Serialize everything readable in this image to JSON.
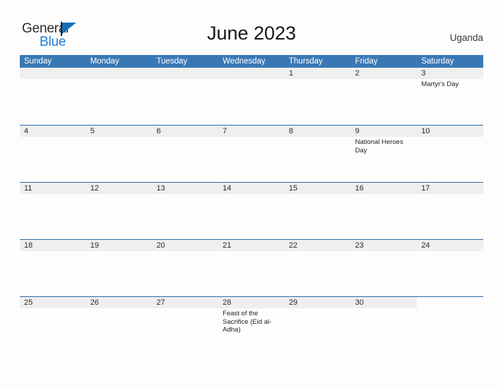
{
  "brand": {
    "name_part1": "General",
    "name_part2": "Blue",
    "flag_icon": "flag-triangle-icon",
    "accent_blue": "#1570b8"
  },
  "header": {
    "title": "June 2023",
    "region": "Uganda"
  },
  "colors": {
    "weekday_header_bg": "#3a78b5",
    "week_divider": "#2b6ca8",
    "daynum_band_bg": "#efefef",
    "page_bg": "#fdfdfd",
    "text": "#2b2b2b"
  },
  "calendar": {
    "month": "June",
    "year": "2023",
    "weekday_headers": [
      "Sunday",
      "Monday",
      "Tuesday",
      "Wednesday",
      "Thursday",
      "Friday",
      "Saturday"
    ],
    "weeks": [
      [
        {
          "day": "",
          "events": []
        },
        {
          "day": "",
          "events": []
        },
        {
          "day": "",
          "events": []
        },
        {
          "day": "",
          "events": []
        },
        {
          "day": "1",
          "events": []
        },
        {
          "day": "2",
          "events": []
        },
        {
          "day": "3",
          "events": [
            "Martyr's Day"
          ]
        }
      ],
      [
        {
          "day": "4",
          "events": []
        },
        {
          "day": "5",
          "events": []
        },
        {
          "day": "6",
          "events": []
        },
        {
          "day": "7",
          "events": []
        },
        {
          "day": "8",
          "events": []
        },
        {
          "day": "9",
          "events": [
            "National Heroes Day"
          ]
        },
        {
          "day": "10",
          "events": []
        }
      ],
      [
        {
          "day": "11",
          "events": []
        },
        {
          "day": "12",
          "events": []
        },
        {
          "day": "13",
          "events": []
        },
        {
          "day": "14",
          "events": []
        },
        {
          "day": "15",
          "events": []
        },
        {
          "day": "16",
          "events": []
        },
        {
          "day": "17",
          "events": []
        }
      ],
      [
        {
          "day": "18",
          "events": []
        },
        {
          "day": "19",
          "events": []
        },
        {
          "day": "20",
          "events": []
        },
        {
          "day": "21",
          "events": []
        },
        {
          "day": "22",
          "events": []
        },
        {
          "day": "23",
          "events": []
        },
        {
          "day": "24",
          "events": []
        }
      ],
      [
        {
          "day": "25",
          "events": []
        },
        {
          "day": "26",
          "events": []
        },
        {
          "day": "27",
          "events": []
        },
        {
          "day": "28",
          "events": [
            "Feast of the Sacrifice (Eid al-Adha)"
          ]
        },
        {
          "day": "29",
          "events": []
        },
        {
          "day": "30",
          "events": []
        },
        {
          "day": "",
          "events": []
        }
      ]
    ]
  }
}
